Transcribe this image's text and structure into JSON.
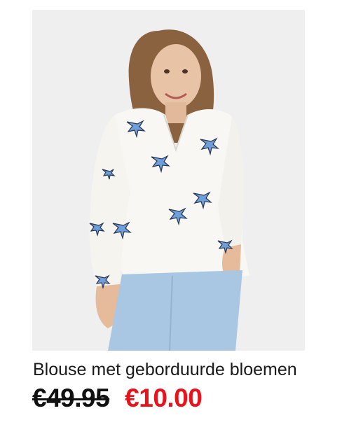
{
  "product": {
    "image_icon": "product-photo",
    "title": "Blouse met geborduurde bloemen",
    "old_price": "€49.95",
    "sale_price": "€10.00"
  },
  "colors": {
    "sale_price": "#e8141c",
    "old_price": "#111111",
    "image_background": "#efefef"
  }
}
